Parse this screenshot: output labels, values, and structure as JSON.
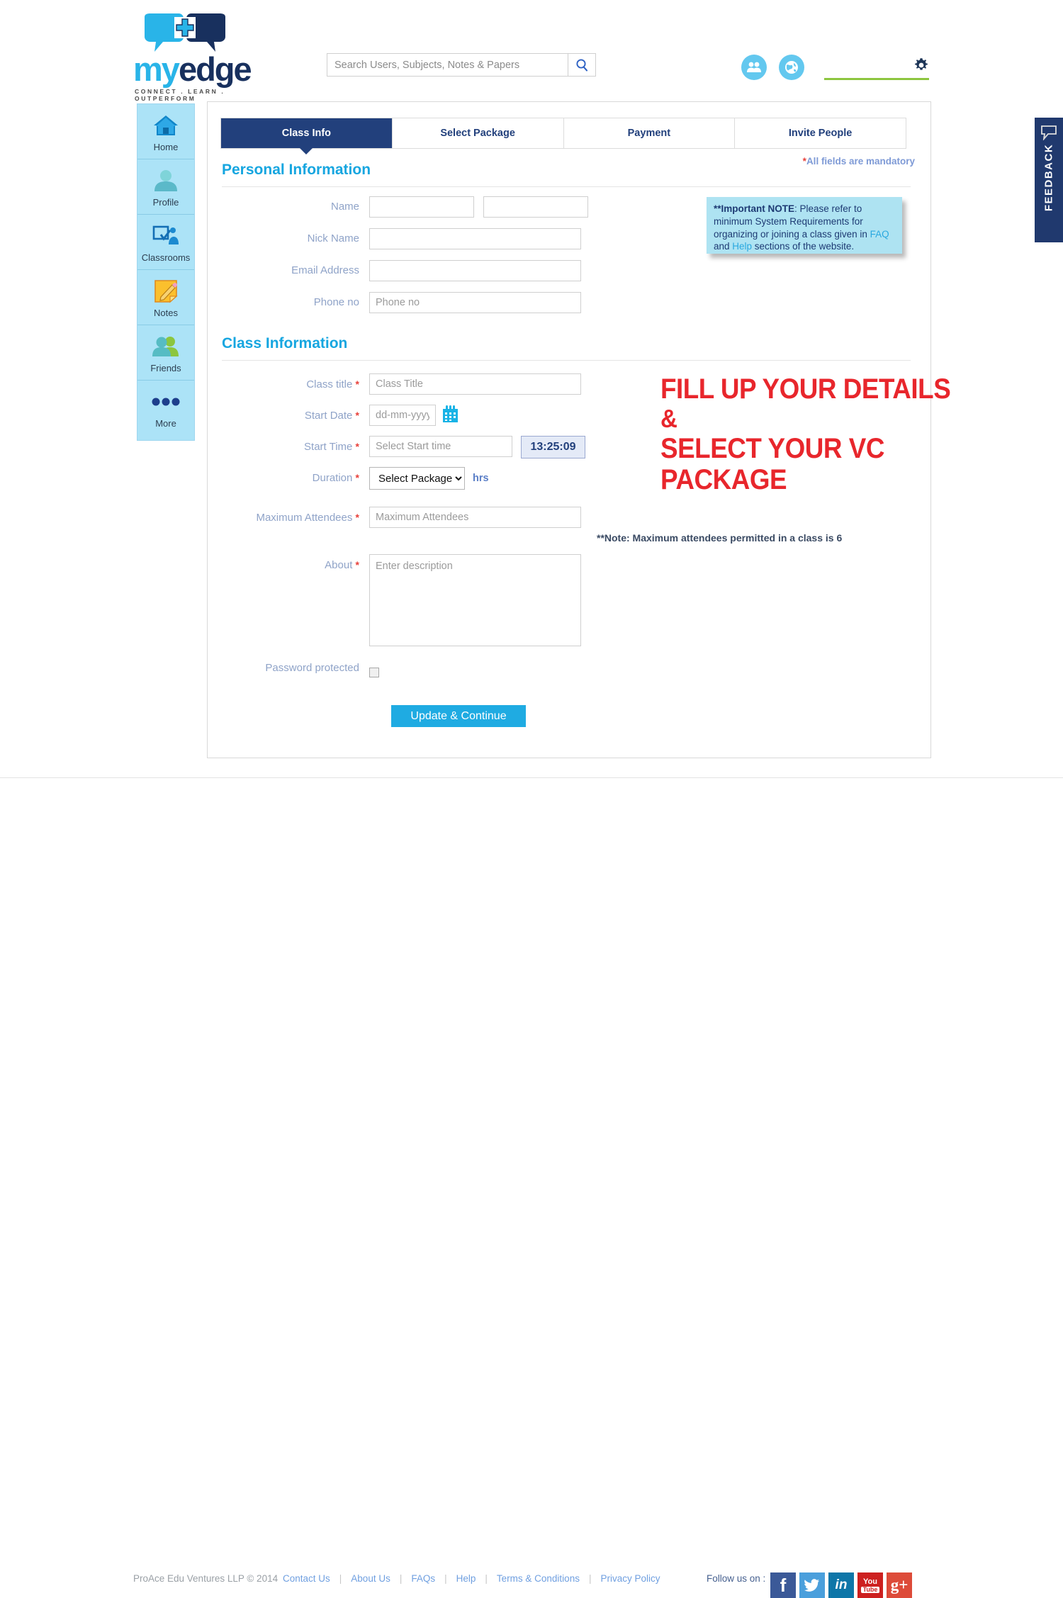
{
  "header": {
    "logo_my": "my",
    "logo_edge": "edge",
    "tagline": "CONNECT . LEARN . OUTPERFORM",
    "search_placeholder": "Search Users, Subjects, Notes & Papers",
    "search_value": "",
    "icons": [
      "friends-icon",
      "world-icon",
      "gear-icon"
    ]
  },
  "sidebar": {
    "items": [
      {
        "label": "Home",
        "icon": "home-icon"
      },
      {
        "label": "Profile",
        "icon": "profile-icon"
      },
      {
        "label": "Classrooms",
        "icon": "classrooms-icon"
      },
      {
        "label": "Notes",
        "icon": "notes-icon"
      },
      {
        "label": "Friends",
        "icon": "friends-icon"
      },
      {
        "label": "More",
        "icon": "more-dots-icon"
      }
    ]
  },
  "tabs": [
    {
      "label": "Class Info",
      "active": true
    },
    {
      "label": "Select Package",
      "active": false
    },
    {
      "label": "Payment",
      "active": false
    },
    {
      "label": "Invite People",
      "active": false
    }
  ],
  "personal_section": {
    "heading": "Personal Information",
    "mandatory_star": "*",
    "mandatory_text": "All fields are mandatory",
    "fields": {
      "name_label": "Name",
      "name_first_value": "",
      "name_first_placeholder": "",
      "name_last_value": "",
      "name_last_placeholder": "",
      "nickname_label": "Nick Name",
      "nickname_value": "",
      "nickname_placeholder": "",
      "email_label": "Email Address",
      "email_value": "",
      "email_placeholder": "",
      "phone_label": "Phone no",
      "phone_value": "",
      "phone_placeholder": "Phone no"
    }
  },
  "note_box": {
    "bold": "**Important NOTE",
    "part1": ": Please refer to minimum System Requirements for organizing or joining a class given in ",
    "link1": "FAQ",
    "part2": " and ",
    "link2": "Help",
    "part3": " sections of the website."
  },
  "class_section": {
    "heading": "Class Information",
    "fields": {
      "class_title_label": "Class title",
      "class_title_value": "",
      "class_title_placeholder": "Class Title",
      "start_date_label": "Start Date",
      "start_date_value": "",
      "start_date_placeholder": "dd-mm-yyyy",
      "calendar_icon": "calendar-icon",
      "start_time_label": "Start Time",
      "start_time_value": "",
      "start_time_placeholder": "Select Start time",
      "clock_value": "13:25:09",
      "duration_label": "Duration",
      "duration_selected": "Select Package",
      "duration_options": [
        "Select Package"
      ],
      "duration_unit": "hrs",
      "max_attendees_label": "Maximum Attendees",
      "max_attendees_value": "",
      "max_attendees_placeholder": "Maximum Attendees",
      "max_attendees_note": "**Note: Maximum attendees permitted in a class is 6",
      "about_label": "About",
      "about_value": "",
      "about_placeholder": "Enter description",
      "password_protected_label": "Password protected",
      "password_protected_checked": false
    },
    "submit_label": "Update & Continue"
  },
  "annotation": {
    "line1": "FILL UP YOUR DETAILS",
    "line2": "&",
    "line3": "SELECT YOUR VC PACKAGE"
  },
  "feedback": {
    "label": "FEEDBACK",
    "icon": "speech-bubble-icon"
  },
  "footer": {
    "copyright": "ProAce Edu Ventures LLP © 2014",
    "links": [
      "Contact Us",
      "About Us",
      "FAQs",
      "Help",
      "Terms & Conditions",
      "Privacy Policy"
    ],
    "follow_label": "Follow us on :",
    "socials": [
      {
        "name": "facebook-icon",
        "glyph": "f",
        "color": "#3b5998"
      },
      {
        "name": "twitter-icon",
        "glyph": "ᵛ",
        "color": "#4a9fdc"
      },
      {
        "name": "linkedin-icon",
        "glyph": "in",
        "color": "#0e76a8"
      },
      {
        "name": "youtube-icon",
        "glyph": "You",
        "color": "#cd201f"
      },
      {
        "name": "googleplus-icon",
        "glyph": "g+",
        "color": "#dd4b39"
      }
    ]
  },
  "colors": {
    "brand_cyan": "#16a6e0",
    "brand_navy": "#22407c",
    "accent_green": "#8dc63f",
    "annotation_red": "#e8262c",
    "sidebar_blue": "#ace3f7",
    "note_blue": "#aee3f2"
  }
}
